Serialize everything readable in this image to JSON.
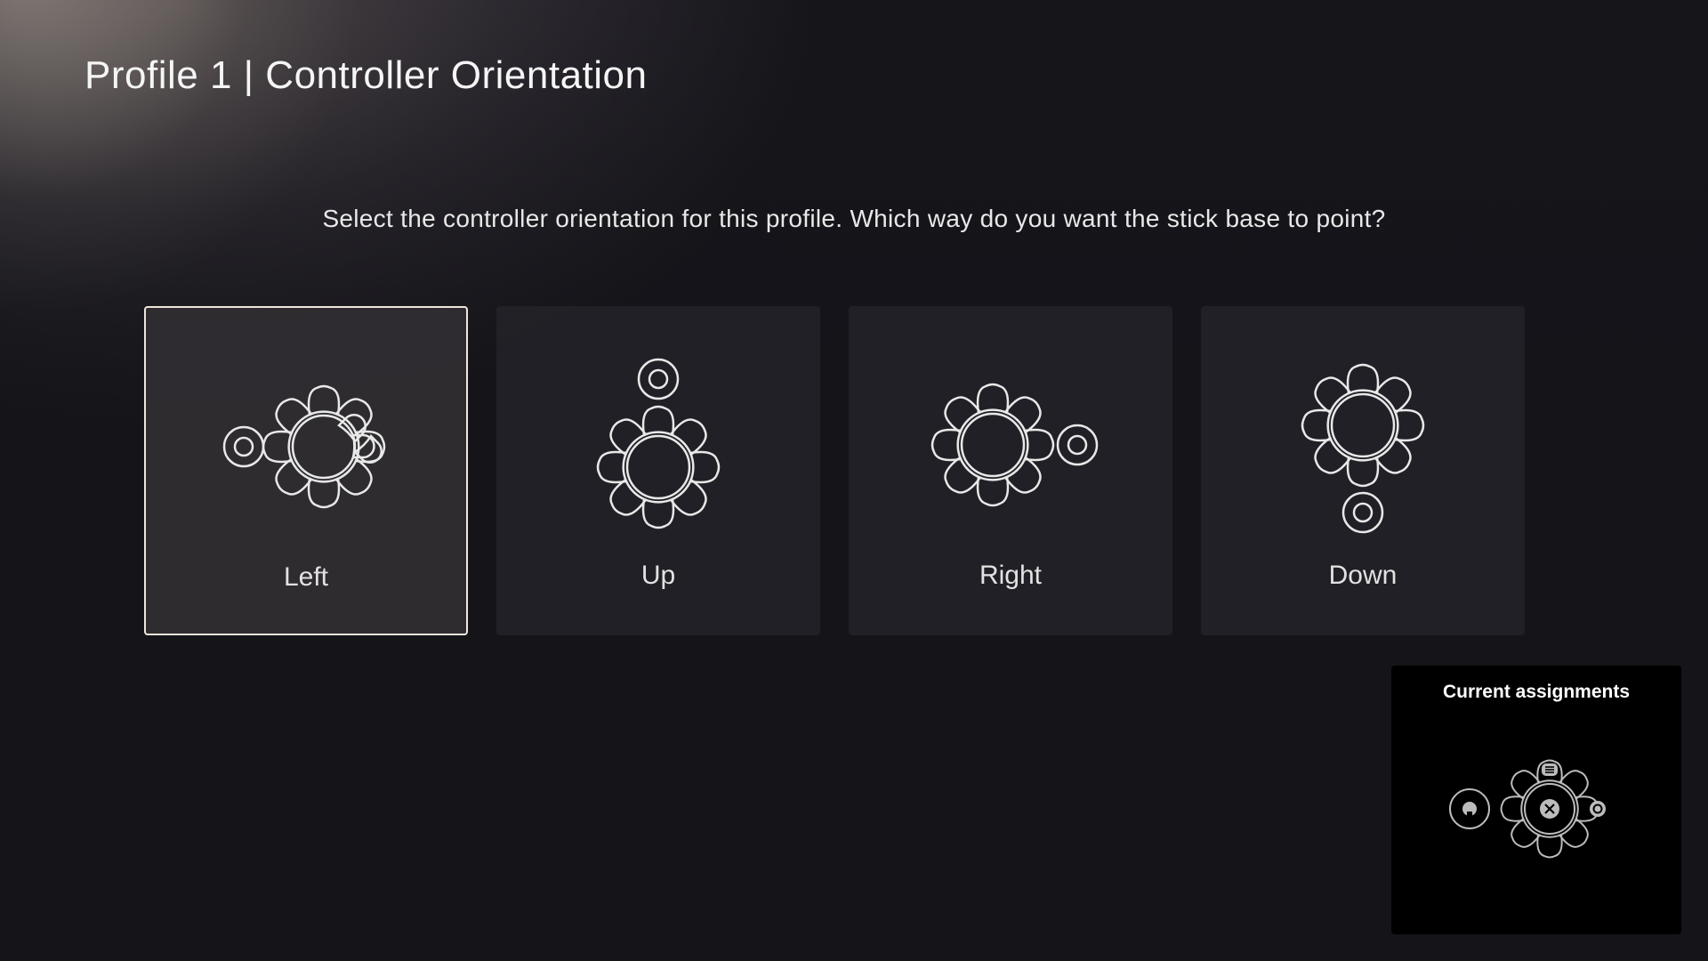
{
  "header": {
    "title": "Profile 1 | Controller Orientation"
  },
  "instruction": "Select the controller orientation for this profile. Which way do you want the stick base to point?",
  "options": [
    {
      "label": "Left",
      "selected": true
    },
    {
      "label": "Up",
      "selected": false
    },
    {
      "label": "Right",
      "selected": false
    },
    {
      "label": "Down",
      "selected": false
    }
  ],
  "assignments": {
    "title": "Current assignments"
  }
}
